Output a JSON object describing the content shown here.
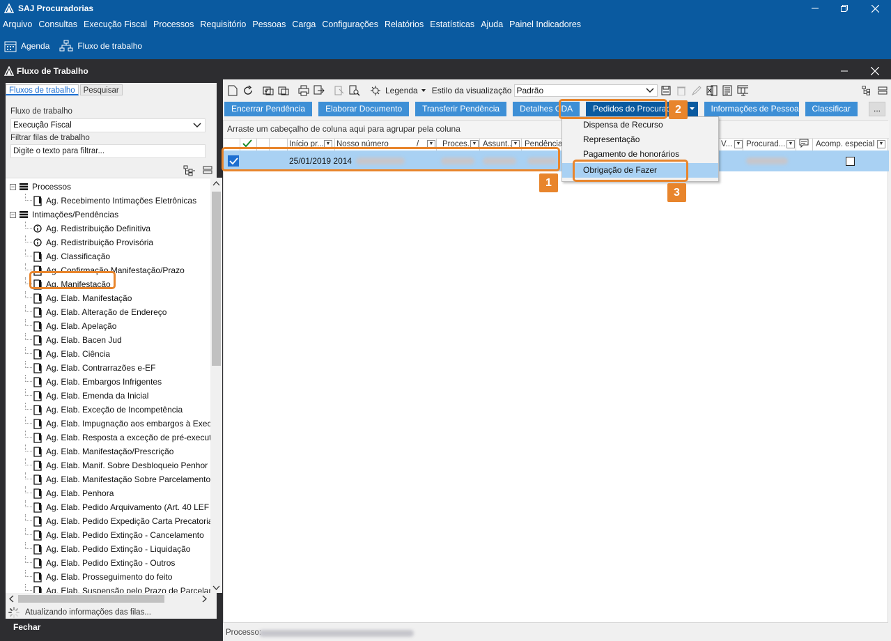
{
  "app": {
    "title": "SAJ Procuradorias"
  },
  "menu": [
    "Arquivo",
    "Consultas",
    "Execução Fiscal",
    "Processos",
    "Requisitório",
    "Pessoas",
    "Carga",
    "Configurações",
    "Relatórios",
    "Estatísticas",
    "Ajuda",
    "Painel Indicadores"
  ],
  "quickbar": {
    "agenda": "Agenda",
    "fluxo": "Fluxo de trabalho"
  },
  "window": {
    "title": "Fluxo de Trabalho"
  },
  "left": {
    "tabs": [
      "Fluxos de trabalho",
      "Pesquisar"
    ],
    "fluxo_label": "Fluxo de trabalho",
    "fluxo_value": "Execução Fiscal",
    "filter_label": "Filtrar filas de trabalho",
    "filter_placeholder": "Digite o texto para filtrar...",
    "status": "Atualizando informações das filas...",
    "close": "Fechar",
    "tree": [
      {
        "label": "Processos",
        "type": "group"
      },
      {
        "label": "Ag. Recebimento Intimações Eletrônicas",
        "type": "doc"
      },
      {
        "label": "Intimações/Pendências",
        "type": "group"
      },
      {
        "label": "Ag. Redistribuição Definitiva",
        "type": "info"
      },
      {
        "label": "Ag. Redistribuição Provisória",
        "type": "info"
      },
      {
        "label": "Ag. Classificação",
        "type": "doc"
      },
      {
        "label": "Ag. Confirmação Manifestação/Prazo",
        "type": "doc"
      },
      {
        "label": "Ag. Manifestação",
        "type": "doc"
      },
      {
        "label": "Ag. Elab. Manifestação",
        "type": "doc"
      },
      {
        "label": "Ag. Elab. Alteração de Endereço",
        "type": "doc"
      },
      {
        "label": "Ag. Elab. Apelação",
        "type": "doc"
      },
      {
        "label": "Ag. Elab. Bacen Jud",
        "type": "doc"
      },
      {
        "label": "Ag. Elab. Ciência",
        "type": "doc"
      },
      {
        "label": "Ag. Elab. Contrarrazões e-EF",
        "type": "doc"
      },
      {
        "label": "Ag. Elab. Embargos Infrigentes",
        "type": "doc"
      },
      {
        "label": "Ag. Elab. Emenda da Inicial",
        "type": "doc"
      },
      {
        "label": "Ag. Elab. Exceção de Incompetência",
        "type": "doc"
      },
      {
        "label": "Ag. Elab. Impugnação aos embargos à Exec",
        "type": "doc"
      },
      {
        "label": "Ag. Elab. Resposta a exceção de pré-execut",
        "type": "doc"
      },
      {
        "label": "Ag. Elab. Manifestação/Prescrição",
        "type": "doc"
      },
      {
        "label": "Ag. Elab. Manif. Sobre Desbloqueio Penhor",
        "type": "doc"
      },
      {
        "label": "Ag. Elab. Manifestação Sobre Parcelamento",
        "type": "doc"
      },
      {
        "label": "Ag. Elab. Penhora",
        "type": "doc"
      },
      {
        "label": "Ag. Elab. Pedido Arquivamento (Art. 40 LEF",
        "type": "doc"
      },
      {
        "label": "Ag. Elab. Pedido Expedição Carta Precatoria",
        "type": "doc"
      },
      {
        "label": "Ag. Elab. Pedido Extinção - Cancelamento",
        "type": "doc"
      },
      {
        "label": "Ag. Elab. Pedido Extinção -  Liquidação",
        "type": "doc"
      },
      {
        "label": "Ag. Elab. Pedido Extinção -  Outros",
        "type": "doc"
      },
      {
        "label": "Ag. Elab. Prosseguimento do feito",
        "type": "doc"
      },
      {
        "label": "Ag. Elab. Suspensão pelo Prazo de Parcelan",
        "type": "doc"
      }
    ]
  },
  "toolbar": {
    "legenda": "Legenda",
    "estilo_label": "Estilo da visualização",
    "estilo_value": "Padrão"
  },
  "actions": {
    "encerrar": "Encerrar Pendência",
    "elaborar": "Elaborar Documento",
    "transferir": "Transferir Pendência",
    "detalhes": "Detalhes CDA",
    "pedidos": "Pedidos do Procurador",
    "informacoes": "Informações de Pessoa",
    "classificar": "Classificar",
    "more": "..."
  },
  "grid": {
    "group_hint": "Arraste um cabeçalho de coluna aqui para agrupar pela coluna",
    "headers": {
      "inicio": "Início pr...",
      "nosso": "Nosso número",
      "slash": "/",
      "processo": "Proces...",
      "assunto": "Assunt...",
      "pendencia": "Pendência",
      "v": "V...",
      "procurador": "Procurad...",
      "acomp": "Acomp. especial"
    },
    "row": {
      "date": "25/01/2019 2014"
    }
  },
  "dropdown": {
    "items": [
      "Dispensa de Recurso",
      "Representação",
      "Pagamento de honorários",
      "Obrigação de Fazer"
    ]
  },
  "status": {
    "processo_label": "Processo:"
  },
  "badges": [
    "1",
    "2",
    "3"
  ],
  "colors": {
    "brand": "#0a5aa0",
    "action": "#3d8fd6",
    "highlight": "#e8852c",
    "selected_row": "#a9d1f3"
  }
}
